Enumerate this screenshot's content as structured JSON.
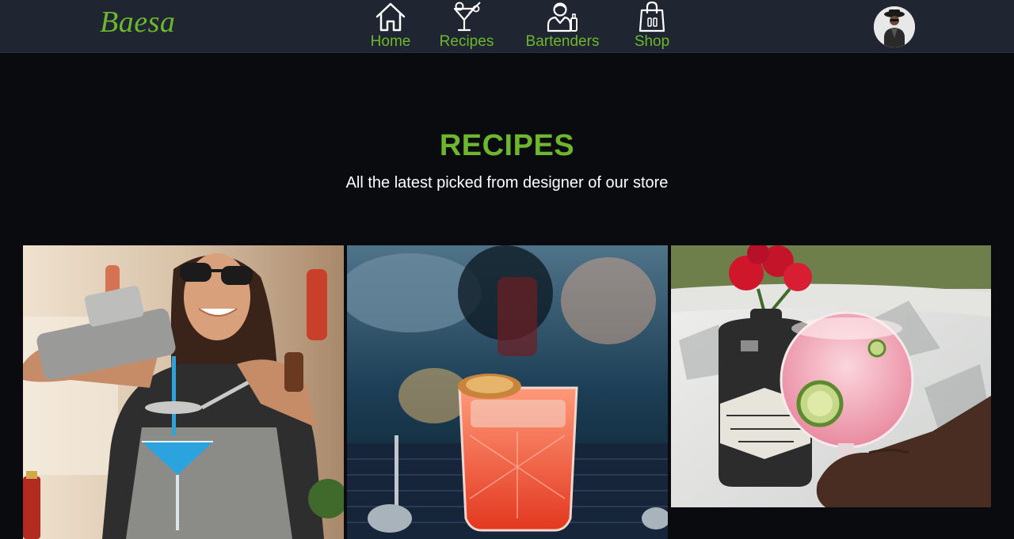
{
  "brand": {
    "logo_text": "Baesa",
    "accent_color": "#6cb72d"
  },
  "nav": {
    "items": [
      {
        "label": "Home",
        "icon": "home-icon"
      },
      {
        "label": "Recipes",
        "icon": "cocktail-icon"
      },
      {
        "label": "Bartenders",
        "icon": "bartender-icon"
      },
      {
        "label": "Shop",
        "icon": "shopping-bag-icon"
      }
    ],
    "avatar": "user-avatar"
  },
  "section": {
    "title": "RECIPES",
    "subtitle": "All the latest picked from designer of our store"
  },
  "recipes": [
    {
      "image": "bartender-pouring-blue-cocktail"
    },
    {
      "image": "red-cocktail-with-dried-citrus"
    },
    {
      "image": "gin-bottle-with-pink-gin-tonic"
    }
  ]
}
